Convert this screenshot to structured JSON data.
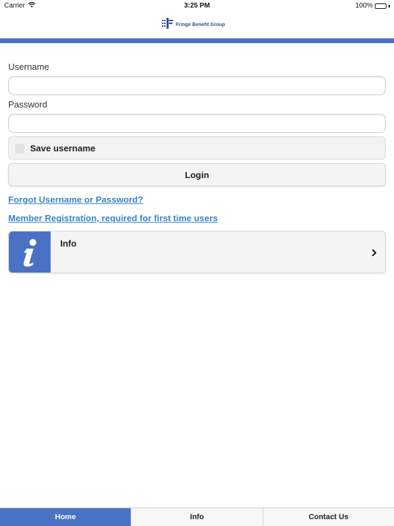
{
  "status_bar": {
    "carrier": "Carrier",
    "time": "3:25 PM",
    "battery": "100%"
  },
  "header": {
    "logo_text": "Fringe Benefit Group",
    "bar_color": "#4a72c4"
  },
  "form": {
    "username_label": "Username",
    "username_value": "",
    "password_label": "Password",
    "password_value": "",
    "save_username_label": "Save username",
    "save_username_checked": false,
    "login_label": "Login"
  },
  "links": {
    "forgot": "Forgot Username or Password?",
    "registration": "Member Registration, required for first time users"
  },
  "info_card": {
    "icon": "info-icon",
    "title": "Info"
  },
  "tabs": [
    {
      "label": "Home",
      "active": true
    },
    {
      "label": "Info",
      "active": false
    },
    {
      "label": "Contact Us",
      "active": false
    }
  ],
  "colors": {
    "accent": "#4a72c4",
    "link": "#3a86c8"
  }
}
